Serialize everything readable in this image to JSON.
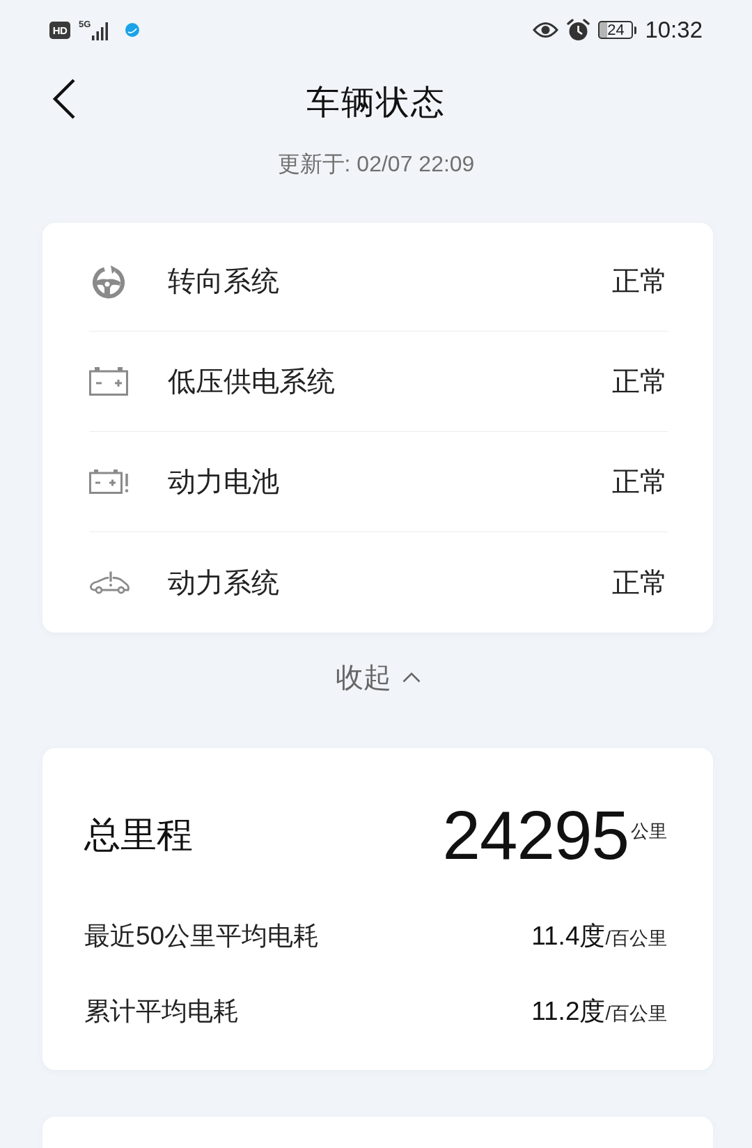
{
  "status_bar": {
    "hd": "HD",
    "network": "5G",
    "battery": "24",
    "time": "10:32"
  },
  "header": {
    "title": "车辆状态",
    "updated": "更新于: 02/07 22:09"
  },
  "systems": [
    {
      "kind": "steering",
      "name": "转向系统",
      "status": "正常"
    },
    {
      "kind": "battery",
      "name": "低压供电系统",
      "status": "正常"
    },
    {
      "kind": "battery-warning",
      "name": "动力电池",
      "status": "正常"
    },
    {
      "kind": "car-warning",
      "name": "动力系统",
      "status": "正常"
    }
  ],
  "collapse_toggle": {
    "label": "收起",
    "expanded": true
  },
  "mileage": {
    "label": "总里程",
    "value": "24295",
    "unit": "公里"
  },
  "consumption": [
    {
      "label": "最近50公里平均电耗",
      "value": "11.4度",
      "unit": "/百公里"
    },
    {
      "label": "累计平均电耗",
      "value": "11.2度",
      "unit": "/百公里"
    }
  ]
}
